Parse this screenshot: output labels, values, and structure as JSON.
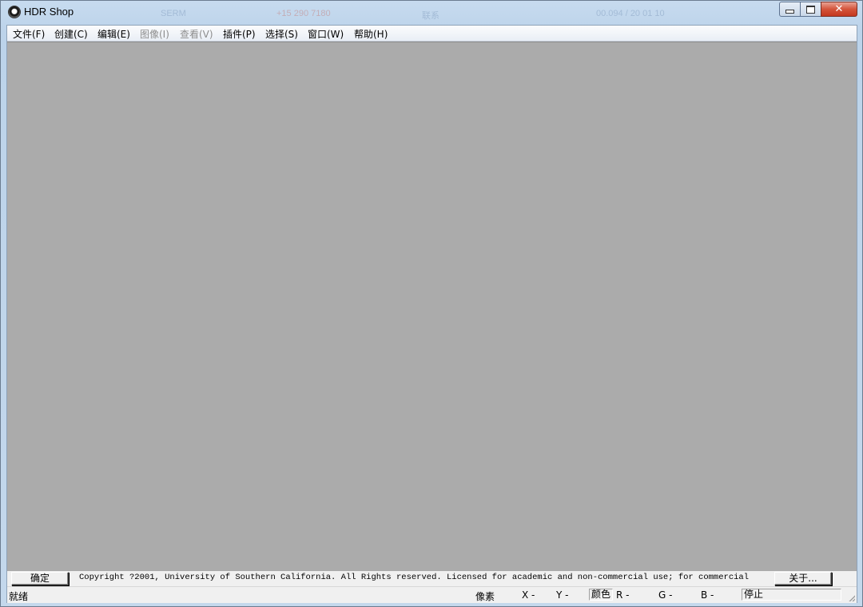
{
  "window": {
    "title": "HDR Shop",
    "background_hints": [
      "SERM",
      "+15 290 7180",
      "联系",
      "00.094 / 20 01 10"
    ]
  },
  "menu": [
    {
      "label": "文件(F)",
      "enabled": true
    },
    {
      "label": "创建(C)",
      "enabled": true
    },
    {
      "label": "编辑(E)",
      "enabled": true
    },
    {
      "label": "图像(I)",
      "enabled": false
    },
    {
      "label": "查看(V)",
      "enabled": false
    },
    {
      "label": "插件(P)",
      "enabled": true
    },
    {
      "label": "选择(S)",
      "enabled": true
    },
    {
      "label": "窗口(W)",
      "enabled": true
    },
    {
      "label": "帮助(H)",
      "enabled": true
    }
  ],
  "infobar": {
    "ok_label": "确定",
    "copyright": "Copyright ?2001, University of Southern California.  All Rights reserved.  Licensed for academic and non-commercial use; for commercial",
    "about_label": "关于..."
  },
  "statusbar": {
    "ready": "就绪",
    "pixel_label": "像素",
    "x": "X -",
    "y": "Y -",
    "color_label": "颜色",
    "r": "R -",
    "g": "G -",
    "b": "B -",
    "state": "停止"
  },
  "colors": {
    "workspace": "#ababab",
    "close_button": "#d4543b",
    "titlebar": "#c7dbef"
  },
  "icons": {
    "app": "hdr-eye-icon",
    "minimize": "minimize-icon",
    "maximize": "maximize-icon",
    "close": "close-icon"
  }
}
